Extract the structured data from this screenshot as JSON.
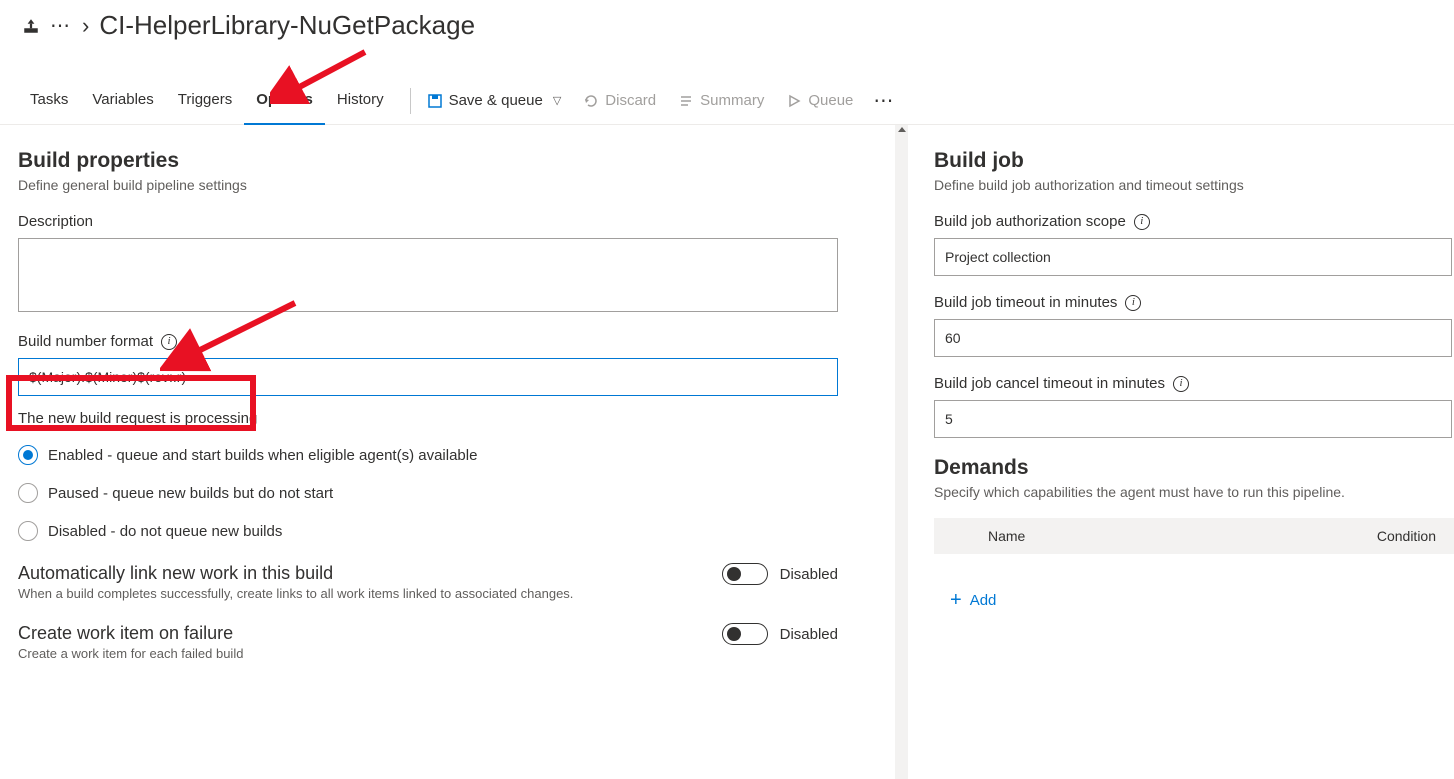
{
  "breadcrumb": {
    "title": "CI-HelperLibrary-NuGetPackage"
  },
  "tabs": {
    "tasks": "Tasks",
    "variables": "Variables",
    "triggers": "Triggers",
    "options": "Options",
    "history": "History"
  },
  "toolbar": {
    "save_queue": "Save & queue",
    "discard": "Discard",
    "summary": "Summary",
    "queue": "Queue"
  },
  "left": {
    "section_title": "Build properties",
    "section_sub": "Define general build pipeline settings",
    "description_label": "Description",
    "description_value": "",
    "build_number_label": "Build number format",
    "build_number_value": "$(Major).$(Minor)$(rev:.r)",
    "processing_text": "The new build request is processing",
    "radio_enabled": "Enabled - queue and start builds when eligible agent(s) available",
    "radio_paused": "Paused - queue new builds but do not start",
    "radio_disabled": "Disabled - do not queue new builds",
    "auto_link_title": "Automatically link new work in this build",
    "auto_link_sub": "When a build completes successfully, create links to all work items linked to associated changes.",
    "auto_link_state": "Disabled",
    "create_wi_title": "Create work item on failure",
    "create_wi_sub": "Create a work item for each failed build",
    "create_wi_state": "Disabled"
  },
  "right": {
    "section_title": "Build job",
    "section_sub": "Define build job authorization and timeout settings",
    "auth_scope_label": "Build job authorization scope",
    "auth_scope_value": "Project collection",
    "timeout_label": "Build job timeout in minutes",
    "timeout_value": "60",
    "cancel_timeout_label": "Build job cancel timeout in minutes",
    "cancel_timeout_value": "5",
    "demands_title": "Demands",
    "demands_sub": "Specify which capabilities the agent must have to run this pipeline.",
    "col_name": "Name",
    "col_condition": "Condition",
    "add_label": "Add"
  }
}
